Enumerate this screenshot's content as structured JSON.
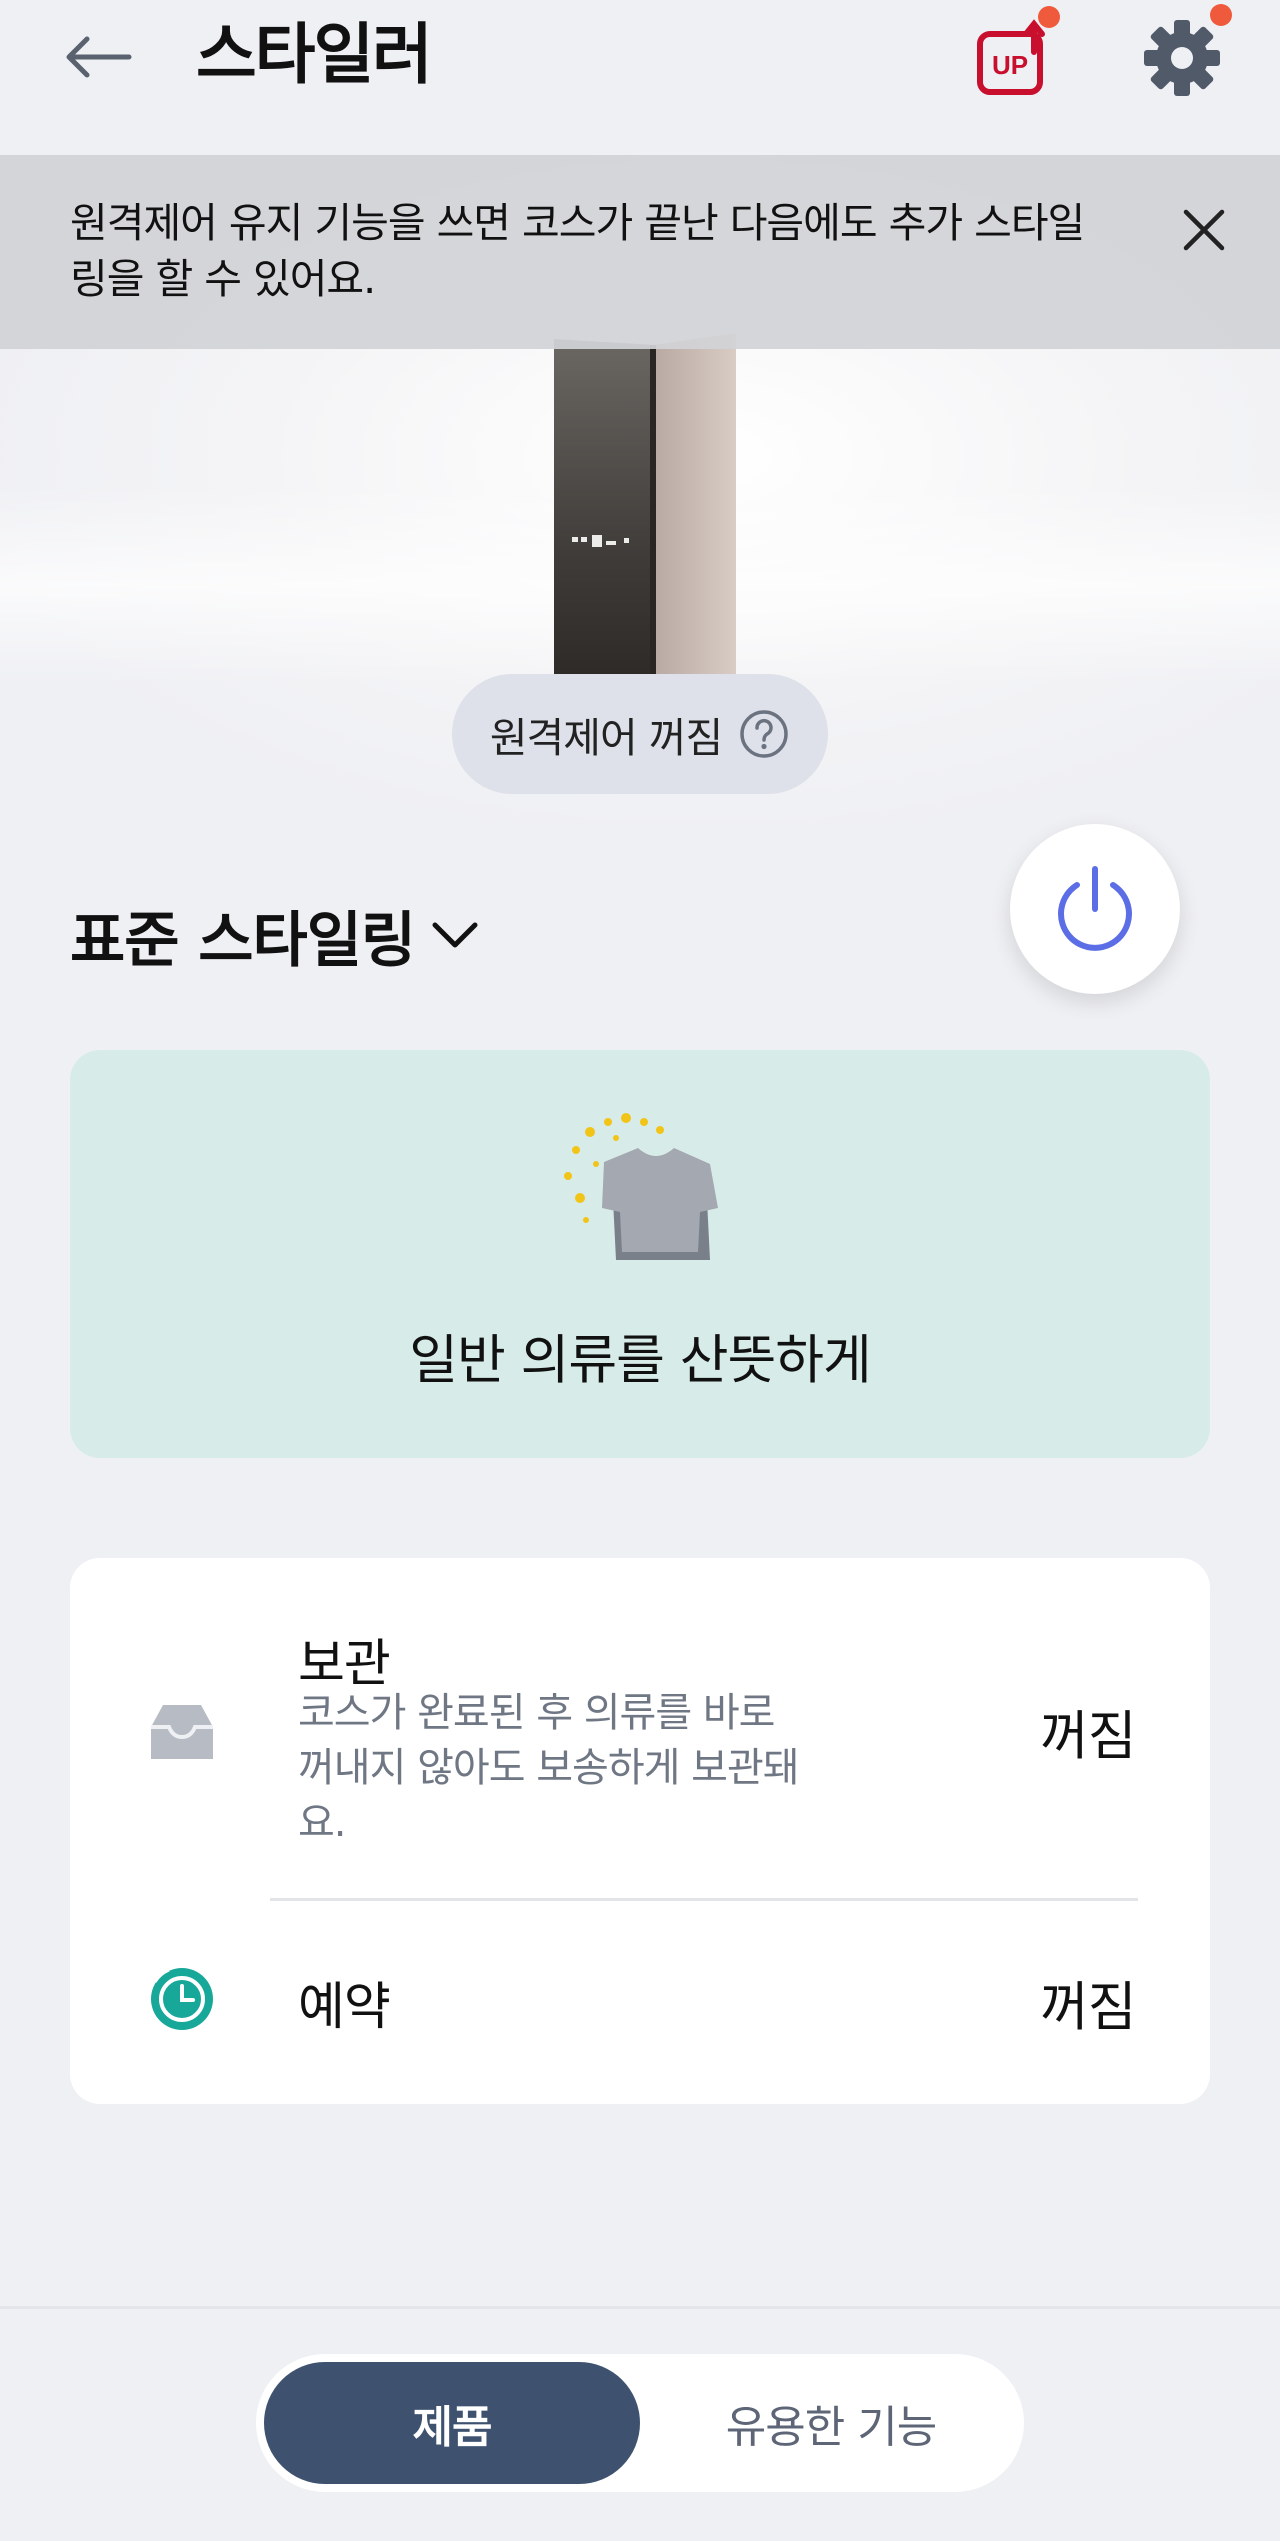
{
  "header": {
    "title": "스타일러",
    "up_label": "UP"
  },
  "notice": {
    "text": "원격제어 유지 기능을 쓰면 코스가 끝난 다음에도 추가 스타일링을 할 수 있어요."
  },
  "remote": {
    "label": "원격제어 꺼짐"
  },
  "course": {
    "name": "표준 스타일링",
    "description": "일반 의류를 산뜻하게"
  },
  "options": [
    {
      "title": "보관",
      "subtitle": "코스가 완료된 후 의류를 바로 꺼내지 않아도 보송하게 보관돼요.",
      "status": "꺼짐",
      "icon": "tray-icon"
    },
    {
      "title": "예약",
      "status": "꺼짐",
      "icon": "clock-icon"
    }
  ],
  "bottom_tabs": {
    "product": "제품",
    "features": "유용한 기능"
  },
  "colors": {
    "accent": "#5c6ee6",
    "active_tab": "#3e5270",
    "course_card": "#d7ece9",
    "badge": "#f05a3c",
    "up_red": "#c8102e",
    "teal": "#17a89a"
  }
}
